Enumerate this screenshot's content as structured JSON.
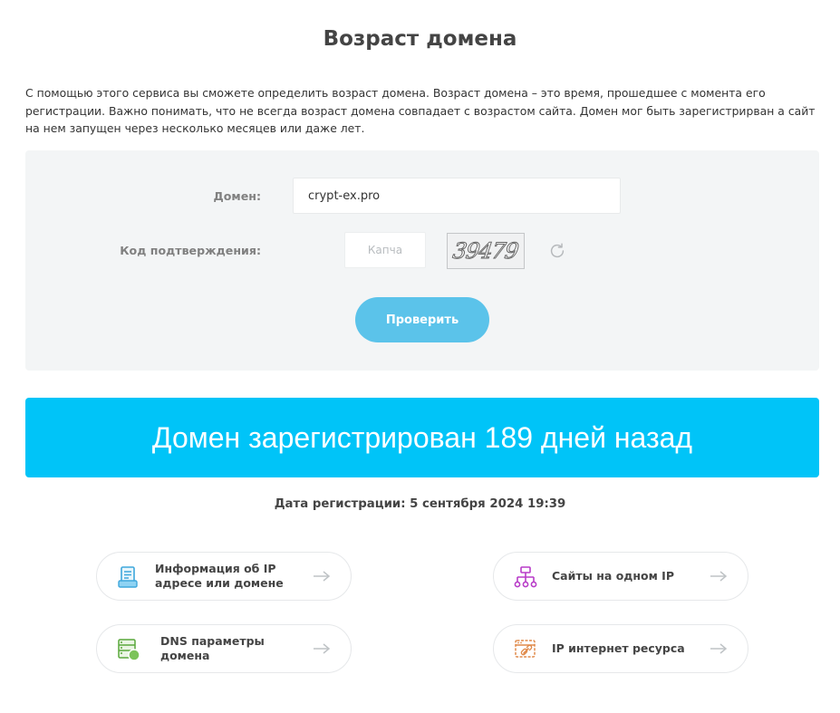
{
  "page": {
    "title": "Возраст домена",
    "intro": "С помощью этого сервиса вы сможете определить возраст домена. Возраст домена – это время, прошедшее с момента его регистрации. Важно понимать, что не всегда возраст домена совпадает с возрастом сайта. Домен мог быть зарегистрирван а сайт на нем запущен через несколько месяцев или даже лет."
  },
  "form": {
    "domain_label": "Домен:",
    "domain_value": "crypt-ex.pro",
    "code_label": "Код подтверждения:",
    "captcha_placeholder": "Капча",
    "captcha_text": "39479",
    "submit_label": "Проверить"
  },
  "result": {
    "banner": "Домен зарегистрирован 189 дней назад",
    "reg_date": "Дата регистрации: 5 сентября 2024 19:39"
  },
  "tools": [
    {
      "label": "Информация об IP адресе или домене",
      "icon": "document-list-icon"
    },
    {
      "label": "Сайты на одном IP",
      "icon": "network-tree-icon"
    },
    {
      "label": "DNS параметры домена",
      "icon": "server-status-icon"
    },
    {
      "label": "IP интернет ресурса",
      "icon": "browser-link-icon"
    }
  ],
  "colors": {
    "accent": "#00c4f8",
    "button": "#5bc3ea",
    "panel": "#f3f5f6"
  }
}
